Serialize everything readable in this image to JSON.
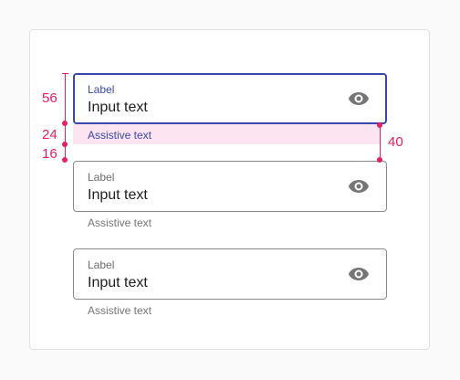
{
  "fields": [
    {
      "label": "Label",
      "value": "Input text",
      "assistive": "Assistive text",
      "state": "focused",
      "icon": "eye-icon"
    },
    {
      "label": "Label",
      "value": "Input text",
      "assistive": "Assistive text",
      "state": "enabled",
      "icon": "eye-icon"
    },
    {
      "label": "Label",
      "value": "Input text",
      "assistive": "Assistive text",
      "state": "enabled",
      "icon": "eye-icon"
    }
  ],
  "redlines": {
    "field_height": "56",
    "assistive_height": "24",
    "gap": "16",
    "combined_height": "40"
  },
  "colors": {
    "accent": "#3949ab",
    "redline": "#e91e63",
    "highlight": "#fce4f1",
    "outline": "#8a8a8a"
  }
}
